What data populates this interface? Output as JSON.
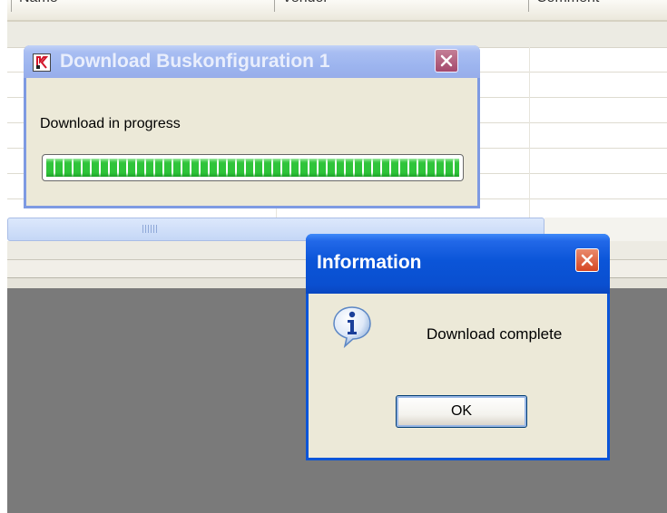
{
  "table": {
    "columns": [
      "Name",
      "Vendor",
      "Comment"
    ]
  },
  "download_window": {
    "title": "Download Buskonfiguration 1",
    "status": "Download in progress",
    "progress_fraction": 1.0,
    "colors": {
      "progress": "#2fc43a",
      "titlebar_inactive": "#9db5ef"
    }
  },
  "info_dialog": {
    "title": "Information",
    "message": "Download complete",
    "ok_label": "OK",
    "icon": "info-icon",
    "colors": {
      "titlebar": "#0b55d8"
    }
  }
}
